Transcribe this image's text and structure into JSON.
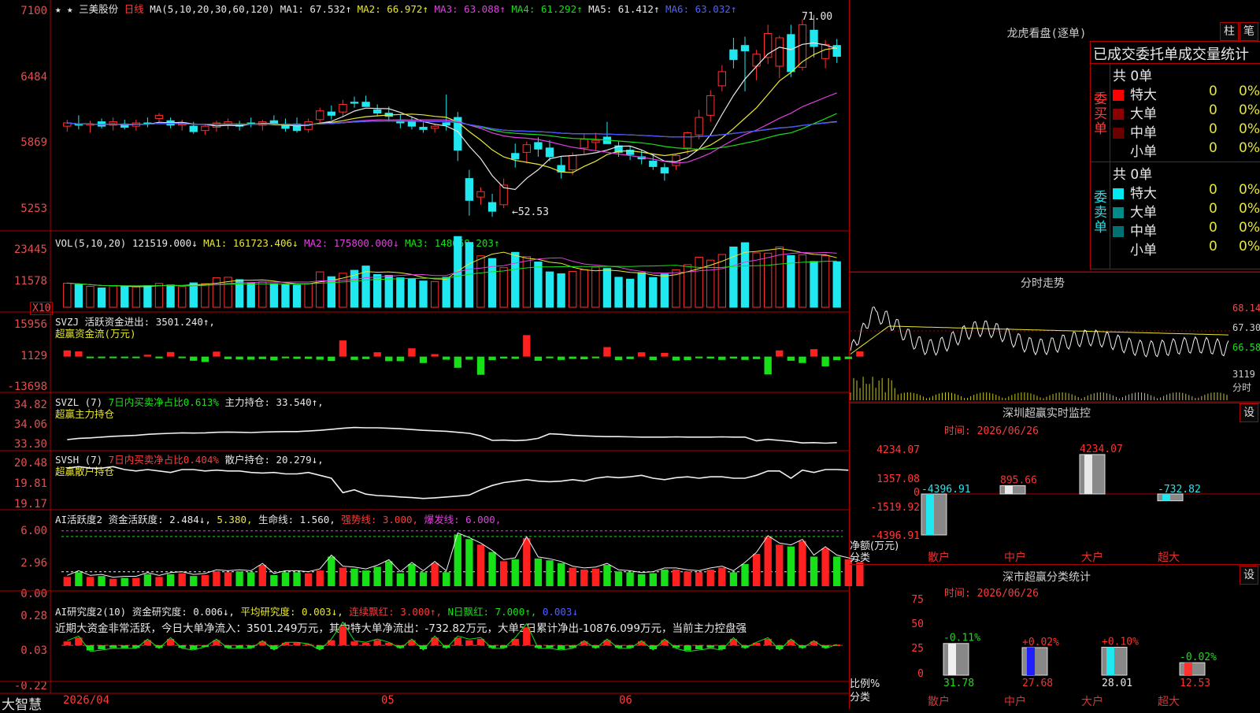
{
  "header": {
    "star": "★ ★",
    "stock_name": "三美股份",
    "period": "日线",
    "ma_setting": "MA(5,10,20,30,60,120)",
    "ma1": "MA1: 67.532↑",
    "ma2": "MA2: 66.972↑",
    "ma3": "MA3: 63.088↑",
    "ma4": "MA4: 61.292↑",
    "ma5": "MA5: 61.412↑",
    "ma6": "MA6: 63.032↑"
  },
  "price_axis": [
    "7100",
    "6484",
    "5869",
    "5253"
  ],
  "price_annotations": {
    "high": "71.00",
    "low": "←52.53"
  },
  "vol_panel": {
    "header": "VOL(5,10,20)",
    "v": "121519.000↓",
    "ma1": "MA1: 161723.406↓",
    "ma2": "MA2: 175800.000↓",
    "ma3": "MA3: 148669.203↑",
    "axis": [
      "23445",
      "11578"
    ],
    "unit": "X10"
  },
  "svzj_panel": {
    "name": "SVZJ",
    "line1": "活跃资金进出: 3501.240↑,",
    "line2": "超赢资金流(万元)",
    "axis": [
      "15956",
      "1129",
      "-13698"
    ]
  },
  "svzl_panel": {
    "name": "SVZL (7)",
    "ratio": "7日内买卖净占比0.613%",
    "hold": "主力持仓: 33.540↑,",
    "line2": "超赢主力持仓",
    "axis": [
      "34.82",
      "34.06",
      "33.30"
    ]
  },
  "svsh_panel": {
    "name": "SVSH (7)",
    "ratio": "7日内买卖净占比0.404%",
    "hold": "散户持仓: 20.279↓,",
    "line2": "超赢散户持仓",
    "axis": [
      "20.48",
      "19.81",
      "19.17"
    ]
  },
  "ai_active_panel": {
    "name": "AI活跃度2",
    "a": "资金活跃度: 2.484↓,",
    "b": "5.380,",
    "c": "生命线: 1.560,",
    "d": "强势线: 3.000,",
    "e": "爆发线: 6.000,",
    "axis": [
      "6.00",
      "2.96",
      "0.00"
    ]
  },
  "ai_research_panel": {
    "name": "AI研究度2(10)",
    "a": "资金研究度: 0.006↓,",
    "b": "平均研究度: 0.003↓,",
    "c": "连续飘红: 3.000↑,",
    "d": "N日飘红: 7.000↑,",
    "e": "0.003↓",
    "comment": "近期大资金非常活跃，今日大单净流入：3501.249万元，其中特大单净流出：-732.82万元，大单5日累计净出-10876.099万元，当前主力控盘强",
    "axis": [
      "0.28",
      "0.03",
      "-0.22"
    ]
  },
  "bottom_bar": {
    "brand": "大智慧",
    "date_start": "2026/04",
    "m05": "05",
    "m06": "06"
  },
  "right_panel": {
    "lhb_title": "龙虎看盘(逐单)",
    "btn_zhu": "柱",
    "btn_bi": "笔",
    "stat_title": "已成交委托单成交量统计",
    "buy_label": "委买单",
    "sell_label": "委卖单",
    "buy_total": "共 0单",
    "sell_total": "共 0单",
    "buy_rows": [
      {
        "name": "特大",
        "count": "0",
        "pct": "0%",
        "color": "#ff0000"
      },
      {
        "name": "大单",
        "count": "0",
        "pct": "0%",
        "color": "#8a0000"
      },
      {
        "name": "中单",
        "count": "0",
        "pct": "0%",
        "color": "#6a0000"
      },
      {
        "name": "小单",
        "count": "0",
        "pct": "0%",
        "color": ""
      }
    ],
    "sell_rows": [
      {
        "name": "特大",
        "count": "0",
        "pct": "0%",
        "color": "#00e8f0"
      },
      {
        "name": "大单",
        "count": "0",
        "pct": "0%",
        "color": "#008a8a"
      },
      {
        "name": "中单",
        "count": "0",
        "pct": "0%",
        "color": "#007070"
      },
      {
        "name": "小单",
        "count": "0",
        "pct": "0%",
        "color": ""
      }
    ],
    "intraday_title": "分时走势",
    "intraday_axis": [
      "68.14",
      "67.30",
      "66.58",
      "3119"
    ],
    "intraday_unit": "分时",
    "monitor_title": "深圳超赢实时监控",
    "monitor_btn": "设",
    "monitor_time": "时间: 2026/06/26",
    "monitor_axis": [
      "4234.07",
      "1357.08",
      "0",
      "-1519.92",
      "-4396.91"
    ],
    "monitor_ylabel1": "净额(万元)",
    "monitor_ylabel2": "分类",
    "monitor_values": [
      "-4396.91",
      "895.66",
      "4234.07",
      "-732.82"
    ],
    "categories": [
      "散户",
      "中户",
      "大户",
      "超大"
    ],
    "class_title": "深市超赢分类统计",
    "class_btn": "设",
    "class_time": "时间: 2026/06/26",
    "class_axis": [
      "75",
      "50",
      "25",
      "0"
    ],
    "class_ylabel1": "比例%",
    "class_ylabel2": "分类",
    "class_changes": [
      "-0.11%",
      "+0.02%",
      "+0.10%",
      "-0.02%"
    ],
    "class_values": [
      "31.78",
      "27.68",
      "28.01",
      "12.53"
    ]
  },
  "chart_data": [
    {
      "type": "candlestick",
      "title": "三美股份 日线",
      "ylim": [
        52.0,
        71.5
      ],
      "candles": [
        [
          60.8,
          61.4,
          60.3,
          61.1
        ],
        [
          61.0,
          61.8,
          60.5,
          60.9
        ],
        [
          60.9,
          61.3,
          60.2,
          61.0
        ],
        [
          61.2,
          61.5,
          60.6,
          60.8
        ],
        [
          60.9,
          61.6,
          60.4,
          61.2
        ],
        [
          61.0,
          61.4,
          60.5,
          60.7
        ],
        [
          60.8,
          61.4,
          60.4,
          61.1
        ],
        [
          61.1,
          61.6,
          60.7,
          61.0
        ],
        [
          61.5,
          62.0,
          61.0,
          61.8
        ],
        [
          61.3,
          61.6,
          60.6,
          60.9
        ],
        [
          60.9,
          61.4,
          60.4,
          61.0
        ],
        [
          60.8,
          61.2,
          60.1,
          60.3
        ],
        [
          60.4,
          61.0,
          60.0,
          60.8
        ],
        [
          60.7,
          61.3,
          60.3,
          61.1
        ],
        [
          61.0,
          61.5,
          60.5,
          61.2
        ],
        [
          60.9,
          61.3,
          60.4,
          60.8
        ],
        [
          61.1,
          61.6,
          60.7,
          61.0
        ],
        [
          60.9,
          61.4,
          60.4,
          61.2
        ],
        [
          61.3,
          61.8,
          60.9,
          61.0
        ],
        [
          61.0,
          61.5,
          60.3,
          60.6
        ],
        [
          61.0,
          61.6,
          60.2,
          60.4
        ],
        [
          60.5,
          61.5,
          60.2,
          61.2
        ],
        [
          61.4,
          62.5,
          61.1,
          62.2
        ],
        [
          62.1,
          62.7,
          61.4,
          61.8
        ],
        [
          62.1,
          63.2,
          61.6,
          62.8
        ],
        [
          63.0,
          63.5,
          62.5,
          62.9
        ],
        [
          63.0,
          63.6,
          62.6,
          62.6
        ],
        [
          62.3,
          62.8,
          61.7,
          62.0
        ],
        [
          62.0,
          62.6,
          61.2,
          61.7
        ],
        [
          61.3,
          61.9,
          60.6,
          61.1
        ],
        [
          61.2,
          61.7,
          60.5,
          60.8
        ],
        [
          60.7,
          61.3,
          60.2,
          60.5
        ],
        [
          60.6,
          61.0,
          60.2,
          60.8
        ],
        [
          61.1,
          63.7,
          60.4,
          60.9
        ],
        [
          61.6,
          62.1,
          57.6,
          58.6
        ],
        [
          56.0,
          56.8,
          52.6,
          54.0
        ],
        [
          54.3,
          55.2,
          53.6,
          54.8
        ],
        [
          53.8,
          54.6,
          52.5,
          53.0
        ],
        [
          53.6,
          56.0,
          53.3,
          55.4
        ],
        [
          58.3,
          59.2,
          57.0,
          57.8
        ],
        [
          58.4,
          59.4,
          57.4,
          59.1
        ],
        [
          59.3,
          59.8,
          58.0,
          58.7
        ],
        [
          58.8,
          59.5,
          57.6,
          58.0
        ],
        [
          57.2,
          58.0,
          56.0,
          56.6
        ],
        [
          56.8,
          58.4,
          56.3,
          58.1
        ],
        [
          58.8,
          60.1,
          58.2,
          59.6
        ],
        [
          59.3,
          60.2,
          58.6,
          59.5
        ],
        [
          59.8,
          61.2,
          59.2,
          59.2
        ],
        [
          59.0,
          59.4,
          58.0,
          58.4
        ],
        [
          58.6,
          59.0,
          57.7,
          58.2
        ],
        [
          58.0,
          58.6,
          57.3,
          57.8
        ],
        [
          57.6,
          58.2,
          56.8,
          57.1
        ],
        [
          57.0,
          57.4,
          55.8,
          56.5
        ],
        [
          57.2,
          58.2,
          56.8,
          58.1
        ],
        [
          58.8,
          60.3,
          58.2,
          60.2
        ],
        [
          60.0,
          62.3,
          59.6,
          61.6
        ],
        [
          61.8,
          64.1,
          61.2,
          63.6
        ],
        [
          64.5,
          66.4,
          64.0,
          65.8
        ],
        [
          67.8,
          68.9,
          66.1,
          66.9
        ],
        [
          68.2,
          69.0,
          64.0,
          67.7
        ],
        [
          66.3,
          67.8,
          65.0,
          67.4
        ],
        [
          67.1,
          70.1,
          66.5,
          69.3
        ],
        [
          66.3,
          69.1,
          65.2,
          68.9
        ],
        [
          69.2,
          70.1,
          65.3,
          65.8
        ],
        [
          66.2,
          70.6,
          65.9,
          70.1
        ],
        [
          69.6,
          71.0,
          67.1,
          68.1
        ],
        [
          67.0,
          68.7,
          66.1,
          68.3
        ],
        [
          68.2,
          68.8,
          66.6,
          67.2
        ]
      ],
      "ma_lines": [
        "MA1",
        "MA2",
        "MA3",
        "MA4",
        "MA5",
        "MA6"
      ]
    },
    {
      "type": "bar",
      "title": "VOL(5,10,20)",
      "ylim": [
        0,
        25000
      ],
      "values": [
        9000,
        8500,
        7800,
        7200,
        7900,
        7800,
        7600,
        8100,
        8900,
        8300,
        7700,
        9100,
        8800,
        11000,
        11200,
        10300,
        9000,
        9500,
        8800,
        8400,
        8300,
        8800,
        13200,
        11400,
        12700,
        13800,
        15400,
        12200,
        11900,
        11000,
        10700,
        9800,
        9600,
        11200,
        26400,
        24200,
        19200,
        18200,
        14800,
        20500,
        18900,
        16900,
        13200,
        12500,
        13400,
        14000,
        15000,
        14500,
        11200,
        10500,
        12900,
        11100,
        12400,
        14000,
        15900,
        18700,
        17600,
        19700,
        22500,
        24100,
        20300,
        20200,
        22500,
        19300,
        19600,
        17100,
        19300,
        17000
      ]
    },
    {
      "type": "bar",
      "title": "SVZJ 超赢资金流(万元)",
      "ylim": [
        -15000,
        17000
      ],
      "values": [
        3000,
        2500,
        -300,
        -400,
        -600,
        -500,
        -700,
        900,
        -800,
        2200,
        -500,
        -2000,
        -2600,
        2400,
        -1200,
        -1400,
        -1500,
        -1200,
        -1800,
        -800,
        -1100,
        -1100,
        -1500,
        -2100,
        7800,
        -1600,
        -1200,
        2100,
        -2200,
        -2200,
        4000,
        -3100,
        1200,
        -1500,
        -5400,
        -1500,
        -8800,
        -1700,
        -900,
        -1100,
        10400,
        -2000,
        -800,
        -1600,
        -1100,
        -1300,
        -800,
        4600,
        -1700,
        -1200,
        2100,
        -1700,
        1800,
        -1900,
        -1700,
        -800,
        -900,
        -1600,
        -900,
        -1600,
        -1200,
        -8600,
        3000,
        -2000,
        -3100,
        3600,
        -4700,
        -1700,
        -1200,
        2500
      ]
    },
    {
      "type": "line",
      "title": "SVZL 超赢主力持仓",
      "ylim": [
        33.2,
        34.95
      ],
      "values": [
        33.45,
        33.5,
        33.52,
        33.55,
        33.58,
        33.6,
        33.62,
        33.66,
        33.68,
        33.7,
        33.72,
        33.71,
        33.72,
        33.74,
        33.75,
        33.74,
        33.73,
        33.75,
        33.76,
        33.77,
        33.77,
        33.79,
        33.82,
        33.86,
        33.9,
        33.93,
        33.92,
        33.92,
        33.9,
        33.88,
        33.85,
        33.82,
        33.8,
        33.78,
        33.74,
        33.7,
        33.6,
        33.42,
        33.43,
        33.41,
        33.43,
        33.5,
        33.68,
        33.66,
        33.62,
        33.6,
        33.58,
        33.57,
        33.57,
        33.56,
        33.55,
        33.55,
        33.55,
        33.56,
        33.55,
        33.55,
        33.55,
        33.56,
        33.55,
        33.55,
        33.4,
        33.46,
        33.42,
        33.38,
        33.32,
        33.33,
        33.31,
        33.33
      ]
    },
    {
      "type": "line",
      "title": "SVSH 超赢散户持仓",
      "ylim": [
        19.1,
        20.6
      ],
      "values": [
        20.35,
        20.4,
        20.35,
        20.35,
        20.4,
        20.3,
        20.25,
        20.3,
        20.25,
        20.2,
        20.3,
        20.3,
        20.25,
        20.28,
        20.25,
        20.25,
        20.2,
        20.18,
        20.2,
        20.15,
        20.15,
        20.2,
        20.1,
        20.0,
        19.5,
        19.6,
        19.45,
        19.4,
        19.38,
        19.35,
        19.33,
        19.3,
        19.32,
        19.35,
        19.38,
        19.42,
        19.6,
        19.75,
        19.85,
        19.9,
        19.95,
        19.9,
        19.88,
        19.9,
        19.95,
        19.9,
        20.0,
        20.05,
        20.02,
        20.05,
        20.1,
        20.0,
        19.95,
        20.02,
        20.05,
        20.0,
        20.05,
        20.05,
        20.0,
        20.0,
        20.1,
        20.25,
        20.25,
        20.0,
        20.28,
        20.2,
        20.3,
        20.3,
        20.279
      ]
    },
    {
      "type": "bar",
      "title": "AI活跃度2",
      "ylim": [
        0,
        7
      ],
      "values": [
        1.0,
        1.5,
        1.0,
        1.1,
        0.8,
        0.9,
        0.9,
        1.3,
        1.0,
        1.3,
        1.4,
        1.1,
        1.2,
        1.6,
        1.5,
        1.6,
        1.5,
        2.3,
        1.2,
        1.5,
        1.5,
        1.4,
        1.7,
        3.2,
        2.0,
        1.9,
        1.7,
        2.1,
        2.7,
        1.4,
        2.4,
        1.5,
        2.5,
        1.5,
        5.6,
        5.1,
        4.5,
        3.7,
        2.7,
        2.9,
        5.2,
        3.0,
        2.8,
        2.5,
        2.0,
        1.8,
        1.9,
        2.3,
        1.6,
        1.5,
        1.3,
        1.4,
        1.8,
        1.8,
        1.6,
        1.5,
        1.8,
        2.0,
        1.5,
        2.4,
        3.5,
        5.3,
        4.5,
        4.3,
        4.9,
        3.2,
        4.1,
        3.2,
        2.9,
        2.6
      ],
      "colors": "red/green by day"
    },
    {
      "type": "bar",
      "title": "AI研究度2(10)",
      "ylim": [
        -0.25,
        0.3
      ],
      "values": [
        0.03,
        0.06,
        -0.04,
        -0.03,
        -0.02,
        -0.02,
        -0.02,
        0.04,
        -0.02,
        0.05,
        -0.02,
        -0.03,
        -0.01,
        0.04,
        -0.02,
        -0.02,
        -0.02,
        0.03,
        -0.03,
        0.02,
        0.02,
        0.01,
        -0.03,
        0.04,
        0.15,
        0.03,
        0.02,
        0.04,
        0.02,
        -0.02,
        0.04,
        -0.03,
        0.06,
        -0.02,
        0.06,
        0.04,
        0.05,
        -0.02,
        -0.02,
        0.05,
        0.14,
        -0.02,
        -0.02,
        -0.03,
        -0.02,
        0.03,
        -0.02,
        0.04,
        -0.02,
        -0.02,
        0.03,
        -0.03,
        0.04,
        -0.02,
        -0.04,
        -0.03,
        -0.02,
        -0.03,
        0.05,
        -0.02,
        0.02,
        0.05,
        -0.03,
        0.04,
        -0.02,
        0.03,
        -0.02,
        0.006
      ]
    },
    {
      "type": "bar",
      "title": "深圳超赢实时监控",
      "categories": [
        "散户",
        "中户",
        "大户",
        "超大"
      ],
      "values": [
        -4396.91,
        895.66,
        4234.07,
        -732.82
      ],
      "ylim": [
        -4396.91,
        4234.07
      ],
      "ylabel": "净额(万元)"
    },
    {
      "type": "bar",
      "title": "深市超赢分类统计",
      "categories": [
        "散户",
        "中户",
        "大户",
        "超大"
      ],
      "values": [
        31.78,
        27.68,
        28.01,
        12.53
      ],
      "changes": [
        "-0.11%",
        "+0.02%",
        "+0.10%",
        "-0.02%"
      ],
      "ylim": [
        0,
        75
      ],
      "ylabel": "比例%"
    }
  ]
}
